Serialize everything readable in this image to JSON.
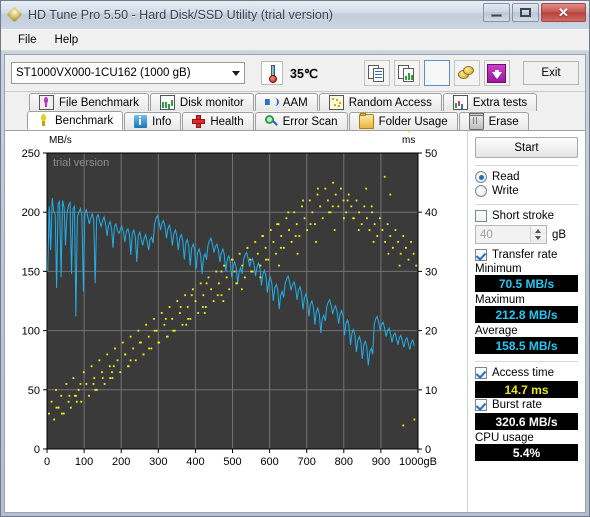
{
  "window": {
    "title": "HD Tune Pro 5.50 - Hard Disk/SSD Utility (trial version)",
    "minimize_label": "",
    "maximize_label": "",
    "close_label": "✕"
  },
  "menu": {
    "items": [
      {
        "label": "File"
      },
      {
        "label": "Help"
      }
    ]
  },
  "toolbar": {
    "drive": "ST1000VX000-1CU162 (1000 gB)",
    "temperature": "35℃",
    "exit_label": "Exit",
    "buttons": [
      {
        "name": "copy-text-icon"
      },
      {
        "name": "copy-image-icon"
      },
      {
        "name": "blank-button"
      },
      {
        "name": "coins-icon"
      },
      {
        "name": "download-icon"
      }
    ]
  },
  "tabs_row1": [
    {
      "label": "File Benchmark",
      "icon": "file-benchmark-icon",
      "active": false
    },
    {
      "label": "Disk monitor",
      "icon": "disk-monitor-icon",
      "active": false
    },
    {
      "label": "AAM",
      "icon": "aam-icon",
      "active": false
    },
    {
      "label": "Random Access",
      "icon": "random-access-icon",
      "active": false
    },
    {
      "label": "Extra tests",
      "icon": "extra-tests-icon",
      "active": false
    }
  ],
  "tabs_row2": [
    {
      "label": "Benchmark",
      "icon": "benchmark-icon",
      "active": true
    },
    {
      "label": "Info",
      "icon": "info-icon",
      "active": false
    },
    {
      "label": "Health",
      "icon": "health-icon",
      "active": false
    },
    {
      "label": "Error Scan",
      "icon": "error-scan-icon",
      "active": false
    },
    {
      "label": "Folder Usage",
      "icon": "folder-usage-icon",
      "active": false
    },
    {
      "label": "Erase",
      "icon": "erase-icon",
      "active": false
    }
  ],
  "side": {
    "start_label": "Start",
    "read_label": "Read",
    "write_label": "Write",
    "read_selected": true,
    "write_selected": false,
    "short_stroke_label": "Short stroke",
    "short_stroke_checked": false,
    "short_stroke_value": "40",
    "short_stroke_unit": "gB",
    "transfer_rate_label": "Transfer rate",
    "transfer_rate_checked": true,
    "minimum_label": "Minimum",
    "minimum_value": "70.5 MB/s",
    "maximum_label": "Maximum",
    "maximum_value": "212.8 MB/s",
    "average_label": "Average",
    "average_value": "158.5 MB/s",
    "access_time_label": "Access time",
    "access_time_checked": true,
    "access_time_value": "14.7 ms",
    "burst_rate_label": "Burst rate",
    "burst_rate_checked": true,
    "burst_rate_value": "320.6 MB/s",
    "cpu_usage_label": "CPU usage",
    "cpu_usage_value": "5.4%"
  },
  "chart_data": {
    "type": "line",
    "title": "",
    "watermark": "trial version",
    "xlabel": "",
    "xunit": "gB",
    "ylabel_left": "MB/s",
    "ylabel_right": "ms",
    "xlim": [
      0,
      1000
    ],
    "ylim_left": [
      0,
      250
    ],
    "ylim_right": [
      0,
      50
    ],
    "xticks": [
      0,
      100,
      200,
      300,
      400,
      500,
      600,
      700,
      800,
      900,
      1000
    ],
    "yticks_left": [
      0,
      50,
      100,
      150,
      200,
      250
    ],
    "yticks_right": [
      0,
      10,
      20,
      30,
      40,
      50
    ],
    "grid": true,
    "plot_bg": "#3a3a3a",
    "colors": {
      "transfer_rate": "#22aee8",
      "access_time": "#f2f20c",
      "grid": "#737373"
    },
    "series": [
      {
        "name": "Transfer rate",
        "axis": "left",
        "color": "#22aee8",
        "unit": "MB/s",
        "x": [
          2,
          6,
          10,
          14,
          18,
          22,
          26,
          30,
          34,
          38,
          42,
          46,
          50,
          54,
          58,
          62,
          66,
          70,
          74,
          78,
          82,
          86,
          90,
          94,
          98,
          102,
          106,
          110,
          114,
          118,
          122,
          126,
          130,
          134,
          138,
          142,
          146,
          150,
          154,
          158,
          162,
          166,
          170,
          174,
          178,
          182,
          186,
          190,
          194,
          198,
          202,
          206,
          210,
          214,
          218,
          222,
          226,
          230,
          234,
          238,
          242,
          246,
          250,
          254,
          258,
          262,
          266,
          270,
          274,
          278,
          282,
          286,
          290,
          294,
          298,
          302,
          306,
          310,
          314,
          318,
          322,
          326,
          330,
          334,
          338,
          342,
          346,
          350,
          354,
          358,
          362,
          366,
          370,
          374,
          378,
          382,
          386,
          390,
          394,
          398,
          402,
          406,
          410,
          414,
          418,
          422,
          426,
          430,
          434,
          438,
          442,
          446,
          450,
          454,
          458,
          462,
          466,
          470,
          474,
          478,
          482,
          486,
          490,
          494,
          498,
          502,
          506,
          510,
          514,
          518,
          522,
          526,
          530,
          534,
          538,
          542,
          546,
          550,
          554,
          558,
          562,
          566,
          570,
          574,
          578,
          582,
          586,
          590,
          594,
          598,
          602,
          606,
          610,
          614,
          618,
          622,
          626,
          630,
          634,
          638,
          642,
          646,
          650,
          654,
          658,
          662,
          666,
          670,
          674,
          678,
          682,
          686,
          690,
          694,
          698,
          702,
          706,
          710,
          714,
          718,
          722,
          726,
          730,
          734,
          738,
          742,
          746,
          750,
          754,
          758,
          762,
          766,
          770,
          774,
          778,
          782,
          786,
          790,
          794,
          798,
          802,
          806,
          810,
          814,
          818,
          822,
          826,
          830,
          834,
          838,
          842,
          846,
          850,
          854,
          858,
          862,
          866,
          870,
          874,
          878,
          882,
          886,
          890,
          894,
          898,
          902,
          906,
          910,
          914,
          918,
          922,
          926,
          930,
          934,
          938,
          942,
          946,
          950,
          954,
          958,
          962,
          966,
          970,
          974,
          978,
          982,
          986,
          990,
          994,
          998
        ],
        "y": [
          150,
          205,
          168,
          212,
          201,
          198,
          136,
          207,
          209,
          145,
          210,
          204,
          172,
          199,
          206,
          208,
          148,
          203,
          205,
          112,
          196,
          200,
          203,
          197,
          133,
          199,
          202,
          196,
          190,
          195,
          199,
          193,
          140,
          196,
          198,
          192,
          188,
          193,
          196,
          190,
          180,
          189,
          192,
          186,
          170,
          188,
          190,
          184,
          182,
          186,
          188,
          183,
          175,
          184,
          186,
          181,
          164,
          182,
          185,
          179,
          158,
          180,
          183,
          177,
          172,
          178,
          181,
          175,
          168,
          177,
          179,
          174,
          190,
          195,
          197,
          192,
          185,
          191,
          193,
          188,
          178,
          186,
          189,
          183,
          172,
          182,
          185,
          180,
          168,
          178,
          181,
          176,
          160,
          174,
          177,
          172,
          155,
          170,
          173,
          168,
          152,
          166,
          169,
          164,
          148,
          162,
          165,
          160,
          172,
          176,
          178,
          173,
          166,
          171,
          173,
          168,
          158,
          166,
          169,
          164,
          150,
          160,
          163,
          158,
          145,
          155,
          158,
          153,
          140,
          150,
          153,
          148,
          160,
          164,
          166,
          161,
          154,
          159,
          161,
          156,
          146,
          154,
          157,
          152,
          138,
          148,
          151,
          146,
          132,
          142,
          145,
          140,
          125,
          136,
          139,
          134,
          118,
          130,
          133,
          128,
          140,
          144,
          146,
          141,
          134,
          139,
          141,
          136,
          126,
          134,
          137,
          132,
          118,
          128,
          131,
          126,
          112,
          122,
          125,
          120,
          105,
          116,
          119,
          114,
          98,
          110,
          113,
          108,
          120,
          124,
          126,
          121,
          114,
          119,
          121,
          116,
          106,
          114,
          117,
          112,
          96,
          106,
          109,
          104,
          88,
          98,
          101,
          96,
          82,
          92,
          95,
          90,
          76,
          88,
          91,
          86,
          70.5,
          82,
          85,
          80,
          105,
          110,
          112,
          107,
          100,
          105,
          107,
          102,
          95,
          100,
          102,
          97,
          90,
          96,
          98,
          93,
          88,
          94,
          96,
          91,
          86,
          92,
          94,
          89,
          84,
          90,
          92,
          87
        ]
      },
      {
        "name": "Access time",
        "axis": "right",
        "color": "#f2f20c",
        "unit": "ms",
        "average": 14.7,
        "x": [
          5,
          12,
          19,
          24,
          31,
          38,
          45,
          52,
          58,
          64,
          71,
          78,
          85,
          92,
          99,
          106,
          113,
          120,
          127,
          134,
          141,
          148,
          155,
          162,
          169,
          176,
          183,
          190,
          197,
          204,
          211,
          218,
          225,
          232,
          239,
          246,
          253,
          260,
          267,
          274,
          281,
          288,
          295,
          302,
          309,
          316,
          323,
          330,
          337,
          344,
          351,
          358,
          365,
          372,
          379,
          386,
          393,
          400,
          407,
          414,
          421,
          428,
          435,
          442,
          449,
          456,
          463,
          470,
          477,
          484,
          491,
          498,
          505,
          512,
          519,
          526,
          533,
          540,
          547,
          554,
          561,
          568,
          575,
          582,
          589,
          596,
          603,
          610,
          617,
          624,
          631,
          638,
          645,
          652,
          659,
          666,
          673,
          680,
          687,
          694,
          701,
          708,
          715,
          722,
          729,
          736,
          743,
          750,
          757,
          764,
          771,
          778,
          785,
          792,
          799,
          806,
          813,
          820,
          827,
          834,
          841,
          848,
          855,
          862,
          869,
          876,
          883,
          890,
          897,
          904,
          911,
          918,
          925,
          932,
          939,
          946,
          953,
          960,
          967,
          974,
          981,
          988,
          995,
          30,
          60,
          90,
          150,
          180,
          210,
          250,
          290,
          320,
          360,
          390,
          430,
          470,
          500,
          540,
          580,
          620,
          650,
          690,
          730,
          770,
          800,
          840,
          880,
          920,
          950,
          990,
          40,
          80,
          130,
          170,
          220,
          260,
          300,
          340,
          380,
          420,
          460,
          510,
          550,
          590,
          630,
          670,
          710,
          760,
          810,
          860,
          910,
          960,
          25,
          75,
          125,
          175,
          225,
          275,
          325,
          375,
          425,
          475,
          525,
          575,
          625,
          675,
          725,
          775,
          825,
          875,
          925,
          975
        ],
        "y": [
          6,
          8,
          5,
          10,
          7,
          9,
          6,
          11,
          8,
          7,
          12,
          9,
          10,
          8,
          13,
          11,
          9,
          14,
          12,
          10,
          15,
          13,
          11,
          16,
          14,
          12,
          17,
          15,
          13,
          18,
          16,
          14,
          19,
          17,
          15,
          20,
          18,
          16,
          21,
          19,
          17,
          22,
          20,
          18,
          23,
          21,
          19,
          24,
          22,
          20,
          25,
          23,
          21,
          26,
          24,
          22,
          27,
          25,
          23,
          28,
          26,
          24,
          29,
          27,
          25,
          30,
          28,
          26,
          31,
          29,
          27,
          32,
          30,
          28,
          33,
          31,
          29,
          34,
          32,
          30,
          35,
          33,
          31,
          36,
          34,
          32,
          37,
          35,
          33,
          38,
          36,
          34,
          39,
          37,
          35,
          40,
          38,
          36,
          41,
          39,
          37,
          42,
          40,
          38,
          43,
          41,
          39,
          44,
          42,
          40,
          45,
          43,
          41,
          44,
          42,
          40,
          43,
          41,
          39,
          42,
          40,
          38,
          41,
          39,
          37,
          40,
          38,
          36,
          39,
          37,
          35,
          38,
          36,
          34,
          37,
          35,
          33,
          36,
          34,
          32,
          35,
          33,
          31,
          7,
          9,
          11,
          12,
          14,
          16,
          18,
          20,
          22,
          24,
          26,
          28,
          30,
          32,
          34,
          36,
          38,
          40,
          42,
          44,
          41,
          39,
          37,
          35,
          33,
          31,
          5,
          6,
          8,
          10,
          12,
          14,
          16,
          18,
          20,
          22,
          24,
          26,
          28,
          30,
          32,
          34,
          36,
          38,
          40,
          42,
          44,
          46,
          4,
          7,
          9,
          11,
          13,
          15,
          17,
          19,
          21,
          23,
          25,
          27,
          29,
          31,
          33,
          35,
          37,
          39,
          41,
          43
        ]
      }
    ]
  }
}
